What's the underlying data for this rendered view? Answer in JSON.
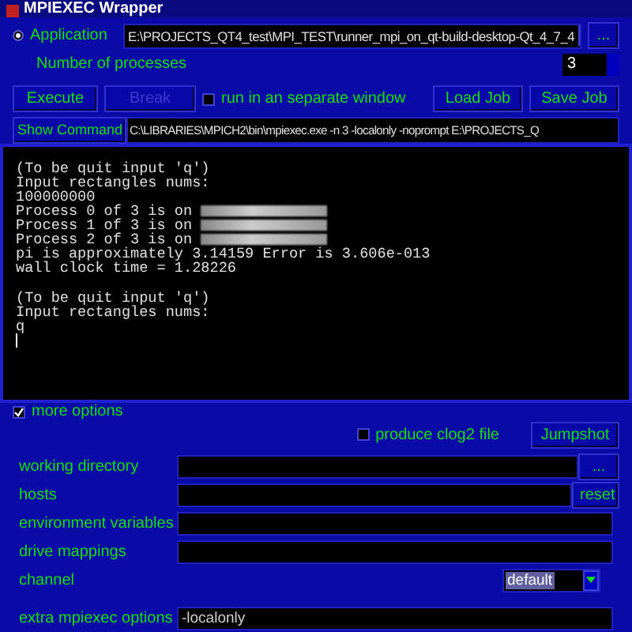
{
  "window": {
    "title": "MPIEXEC Wrapper"
  },
  "application": {
    "label": "Application",
    "selected": true,
    "value": "E:\\PROJECTS_QT4_test\\MPI_TEST\\runner_mpi_on_qt-build-desktop-Qt_4_7_4",
    "browse": "..."
  },
  "processes": {
    "label": "Number of processes",
    "value": "3"
  },
  "actions": [
    {
      "label": "Execute",
      "disabled": false
    },
    {
      "label": "Break",
      "disabled": true
    }
  ],
  "separate_window": {
    "label": "run in an separate window",
    "checked": false
  },
  "jobs": [
    {
      "label": "Load Job"
    },
    {
      "label": "Save Job"
    }
  ],
  "show_command": {
    "label": "Show Command",
    "value": "C:\\LIBRARIES\\MPICH2\\bin\\mpiexec.exe -n 3  -localonly -noprompt E:\\PROJECTS_Q"
  },
  "console": [
    {
      "kind": "blank"
    },
    {
      "kind": "text",
      "text": "(To be quit input 'q')"
    },
    {
      "kind": "text",
      "text": "Input rectangles nums:"
    },
    {
      "kind": "text",
      "text": "100000000"
    },
    {
      "kind": "host",
      "text": "Process 0 of 3 is on"
    },
    {
      "kind": "host",
      "text": "Process 1 of 3 is on"
    },
    {
      "kind": "host",
      "text": "Process 2 of 3 is on"
    },
    {
      "kind": "text",
      "text": "pi is approximately 3.14159 Error is 3.606e-013"
    },
    {
      "kind": "text",
      "text": "wall clock time = 1.28226"
    },
    {
      "kind": "blank"
    },
    {
      "kind": "text",
      "text": "(To be quit input 'q')"
    },
    {
      "kind": "text",
      "text": "Input rectangles nums:"
    },
    {
      "kind": "text",
      "text": "q"
    },
    {
      "kind": "cursor"
    }
  ],
  "more_options": {
    "label": "more options",
    "checked": true
  },
  "clog2": {
    "label": "produce clog2 file",
    "checked": false
  },
  "jumpshot": {
    "label": "Jumpshot"
  },
  "options": [
    {
      "kind": "browse",
      "label": "working directory",
      "button": "..."
    },
    {
      "kind": "button",
      "label": "hosts",
      "button": "reset"
    },
    {
      "kind": "field",
      "label": "environment variables"
    },
    {
      "kind": "field",
      "label": "drive mappings"
    },
    {
      "kind": "select",
      "label": "channel",
      "value": "default"
    },
    {
      "kind": "field",
      "label": "extra mpiexec options",
      "value": "-localonly"
    }
  ]
}
